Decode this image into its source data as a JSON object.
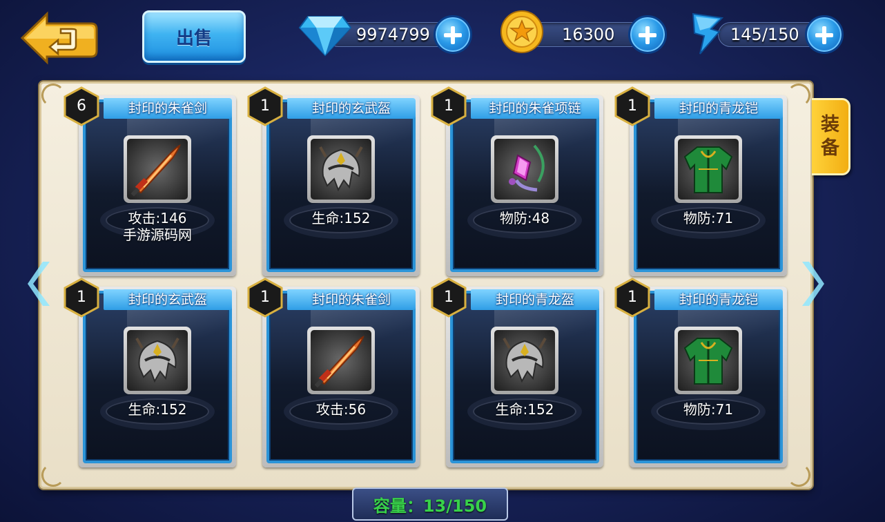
{
  "toolbar": {
    "sell_label": "出售"
  },
  "resources": {
    "diamonds": "9974799",
    "gold": "16300",
    "stamina": "145/150"
  },
  "side_tab": {
    "label_1": "装",
    "label_2": "备"
  },
  "items": [
    {
      "count": "6",
      "name": "封印的朱雀剑",
      "stat": "攻击:146",
      "sub": "手游源码网",
      "type": "sword"
    },
    {
      "count": "1",
      "name": "封印的玄武盔",
      "stat": "生命:152",
      "sub": "",
      "type": "helmet"
    },
    {
      "count": "1",
      "name": "封印的朱雀项链",
      "stat": "物防:48",
      "sub": "",
      "type": "necklace"
    },
    {
      "count": "1",
      "name": "封印的青龙铠",
      "stat": "物防:71",
      "sub": "",
      "type": "armor"
    },
    {
      "count": "1",
      "name": "封印的玄武盔",
      "stat": "生命:152",
      "sub": "",
      "type": "helmet"
    },
    {
      "count": "1",
      "name": "封印的朱雀剑",
      "stat": "攻击:56",
      "sub": "",
      "type": "sword"
    },
    {
      "count": "1",
      "name": "封印的青龙盔",
      "stat": "生命:152",
      "sub": "",
      "type": "helmet"
    },
    {
      "count": "1",
      "name": "封印的青龙铠",
      "stat": "物防:71",
      "sub": "",
      "type": "armor"
    }
  ],
  "capacity": "容量：13/150",
  "colors": {
    "card_border": "#2b94d8",
    "name_bar": "#2f9ee6",
    "tab": "#f2ae12",
    "capacity_text": "#38d24a"
  }
}
